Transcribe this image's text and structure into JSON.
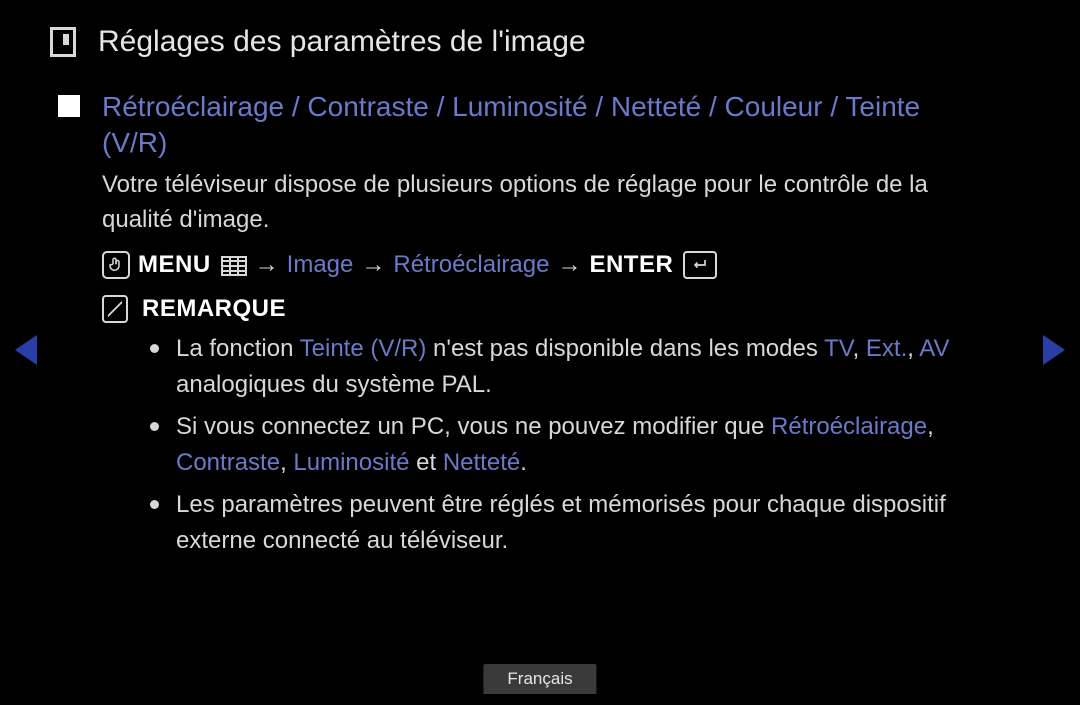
{
  "title": "Réglages des paramètres de l'image",
  "section": {
    "heading": "Rétroéclairage / Contraste / Luminosité / Netteté / Couleur / Teinte (V/R)",
    "intro": "Votre téléviseur dispose de plusieurs options de réglage pour le contrôle de la qualité d'image."
  },
  "path": {
    "menu_label": "MENU",
    "sep": "→",
    "step1": "Image",
    "step2": "Rétroéclairage",
    "enter_label": "ENTER"
  },
  "remark_label": "REMARQUE",
  "notes": {
    "n1": {
      "t1": "La fonction ",
      "h1": "Teinte (V/R)",
      "t2": " n'est pas disponible dans les modes ",
      "h2": "TV",
      "t3": ", ",
      "h3": "Ext.",
      "t4": ", ",
      "h4": "AV",
      "t5": " analogiques du système PAL."
    },
    "n2": {
      "t1": "Si vous connectez un PC, vous ne pouvez modifier que ",
      "h1": "Rétroéclairage",
      "t2": ", ",
      "h2": "Contraste",
      "t3": ", ",
      "h3": "Luminosité",
      "t4": " et ",
      "h4": "Netteté",
      "t5": "."
    },
    "n3": {
      "t1": "Les paramètres peuvent être réglés et mémorisés pour chaque dispositif externe connecté au téléviseur."
    }
  },
  "language": "Français"
}
